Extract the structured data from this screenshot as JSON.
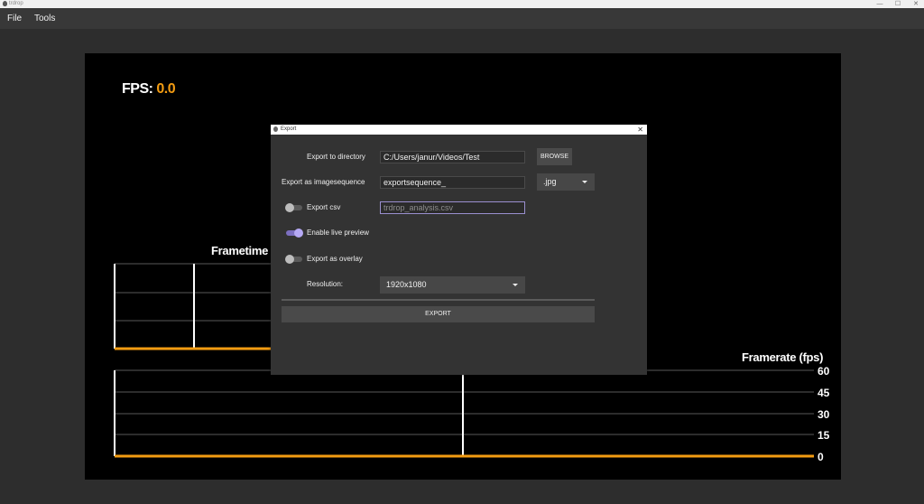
{
  "window": {
    "title": "trdrop",
    "minimize": "—",
    "maximize": "☐",
    "close": "✕"
  },
  "menu": {
    "file": "File",
    "tools": "Tools"
  },
  "canvas": {
    "fps_label": "FPS:",
    "fps_value": "0.0",
    "frametime_title": "Frametime (",
    "framerate_title": "Framerate (fps)"
  },
  "chart_data": [
    {
      "type": "line",
      "title": "Frametime (",
      "series": [
        {
          "values": [
            0,
            0
          ]
        }
      ]
    },
    {
      "type": "line",
      "title": "Framerate (fps)",
      "yticks": [
        "60",
        "45",
        "30",
        "15",
        "0"
      ],
      "ylim": [
        0,
        60
      ],
      "series": [
        {
          "values": [
            0,
            0
          ]
        }
      ],
      "grid": true,
      "colors": {
        "line": "#f39c12",
        "grid": "#ffffff"
      }
    }
  ],
  "dialog": {
    "title": "Export",
    "close": "✕",
    "export_dir_label": "Export to directory",
    "export_dir_value": "C:/Users/janur/Videos/Test",
    "browse_label": "BROWSE",
    "imageseq_label": "Export as imagesequence",
    "imageseq_value": "exportsequence_",
    "format_value": ".jpg",
    "csv_label": "Export csv",
    "csv_placeholder": "trdrop_analysis.csv",
    "csv_enabled": false,
    "live_preview_label": "Enable live preview",
    "live_preview_enabled": true,
    "overlay_label": "Export as overlay",
    "overlay_enabled": false,
    "resolution_label": "Resolution:",
    "resolution_value": "1920x1080",
    "export_button": "EXPORT"
  },
  "colors": {
    "accent_orange": "#f39c12",
    "toggle_on": "#b6a9f5",
    "background": "#2d2d2d"
  }
}
